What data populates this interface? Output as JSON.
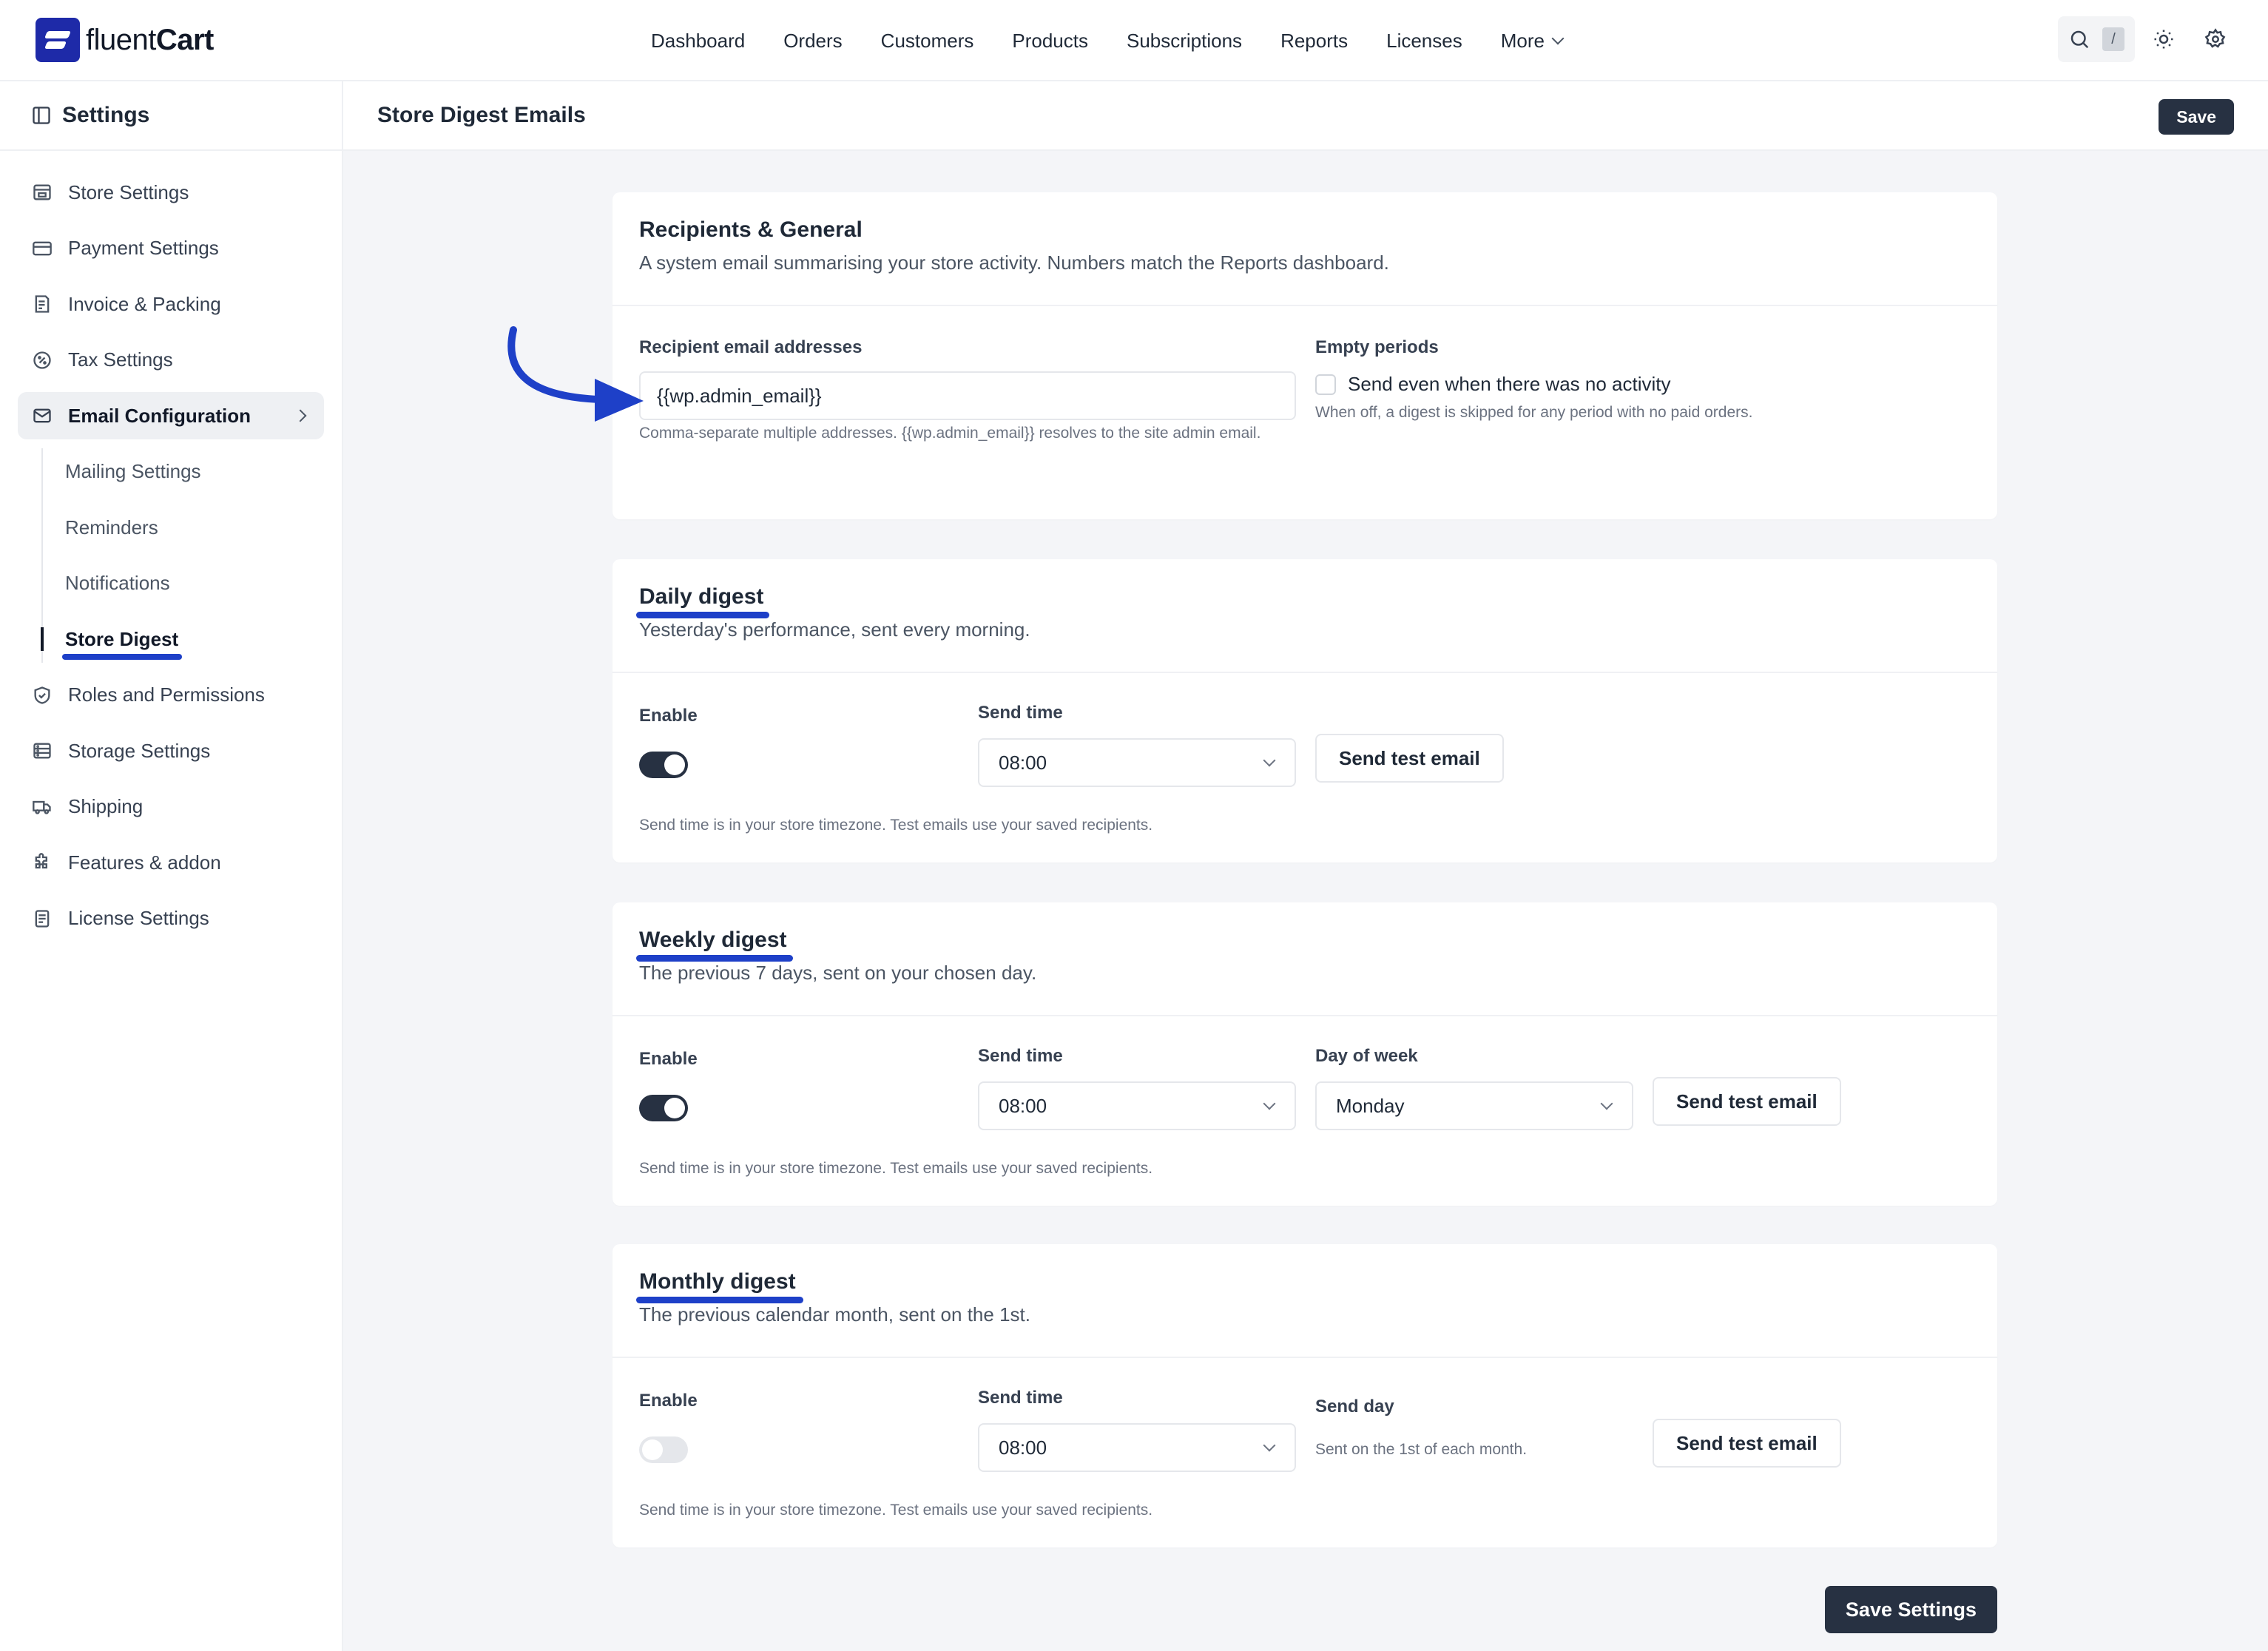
{
  "brand": {
    "name_light": "fluent",
    "name_bold": "Cart"
  },
  "nav": [
    "Dashboard",
    "Orders",
    "Customers",
    "Products",
    "Subscriptions",
    "Reports",
    "Licenses"
  ],
  "nav_more": "More",
  "search": {
    "shortcut": "/"
  },
  "sidebar": {
    "title": "Settings",
    "items": [
      {
        "label": "Store Settings",
        "icon": "store-icon"
      },
      {
        "label": "Payment Settings",
        "icon": "credit-card-icon"
      },
      {
        "label": "Invoice & Packing",
        "icon": "invoice-icon"
      },
      {
        "label": "Tax Settings",
        "icon": "percent-icon"
      },
      {
        "label": "Email Configuration",
        "icon": "mail-icon"
      },
      {
        "label": "Roles and Permissions",
        "icon": "shield-check-icon"
      },
      {
        "label": "Storage Settings",
        "icon": "storage-icon"
      },
      {
        "label": "Shipping",
        "icon": "truck-icon"
      },
      {
        "label": "Features & addon",
        "icon": "puzzle-icon"
      },
      {
        "label": "License Settings",
        "icon": "license-icon"
      }
    ],
    "sub_items": [
      "Mailing Settings",
      "Reminders",
      "Notifications",
      "Store Digest"
    ]
  },
  "page": {
    "title": "Store Digest Emails",
    "save_label": "Save",
    "save_settings_label": "Save Settings"
  },
  "general": {
    "title": "Recipients & General",
    "desc": "A system email summarising your store activity. Numbers match the Reports dashboard.",
    "recipients_label": "Recipient email addresses",
    "recipients_value": "{{wp.admin_email}}",
    "recipients_help": "Comma-separate multiple addresses. {{wp.admin_email}} resolves to the site admin email.",
    "empty_label": "Empty periods",
    "empty_checkbox_label": "Send even when there was no activity",
    "empty_help": "When off, a digest is skipped for any period with no paid orders."
  },
  "daily": {
    "title": "Daily digest",
    "desc": "Yesterday's performance, sent every morning.",
    "enable_label": "Enable",
    "enabled": true,
    "time_label": "Send time",
    "time_value": "08:00",
    "test_label": "Send test email",
    "help": "Send time is in your store timezone. Test emails use your saved recipients."
  },
  "weekly": {
    "title": "Weekly digest",
    "desc": "The previous 7 days, sent on your chosen day.",
    "enable_label": "Enable",
    "enabled": true,
    "time_label": "Send time",
    "time_value": "08:00",
    "day_label": "Day of week",
    "day_value": "Monday",
    "test_label": "Send test email",
    "help": "Send time is in your store timezone. Test emails use your saved recipients."
  },
  "monthly": {
    "title": "Monthly digest",
    "desc": "The previous calendar month, sent on the 1st.",
    "enable_label": "Enable",
    "enabled": false,
    "time_label": "Send time",
    "time_value": "08:00",
    "day_label": "Send day",
    "day_help": "Sent on the 1st of each month.",
    "test_label": "Send test email",
    "help": "Send time is in your store timezone. Test emails use your saved recipients."
  },
  "colors": {
    "accent": "#1e40c8",
    "brand": "#1e2aa8",
    "dark_button": "#273142"
  }
}
